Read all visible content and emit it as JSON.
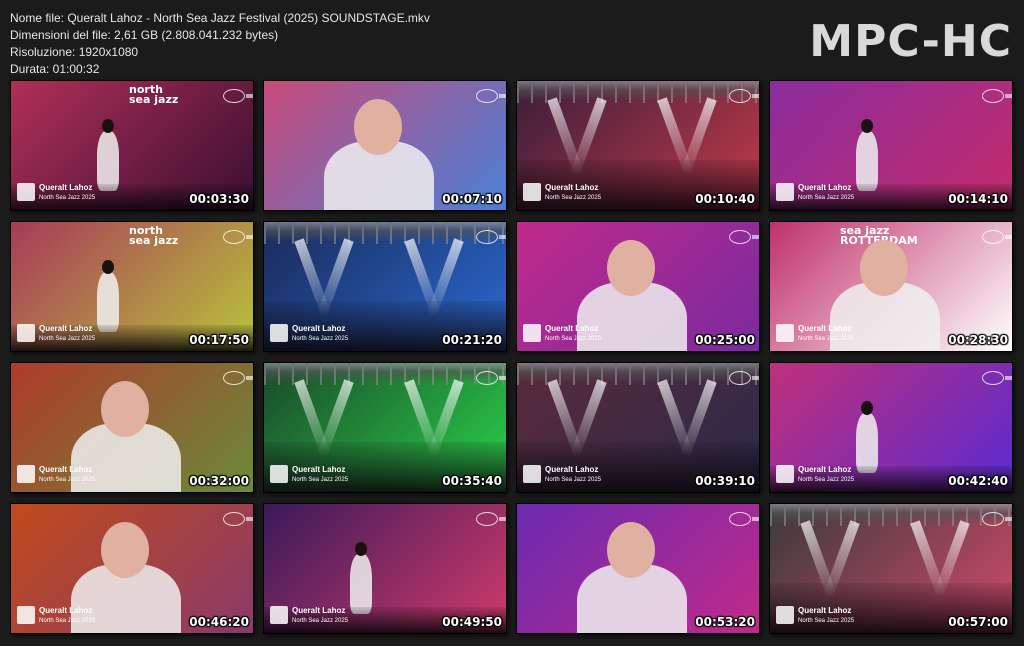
{
  "info": {
    "filename": "Nome file: Queralt Lahoz - North Sea Jazz Festival (2025) SOUNDSTAGE.mkv",
    "filesize": "Dimensioni del file: 2,61 GB (2.808.041.232 bytes)",
    "resolution": "Risoluzione: 1920x1080",
    "duration": "Durata: 01:00:32"
  },
  "brand": "MPC-HC",
  "lower_third": {
    "name": "Queralt Lahoz",
    "event": "North Sea Jazz 2025"
  },
  "thumbs": [
    {
      "time": "00:03:30",
      "colors": [
        "#b02f58",
        "#3a0f30"
      ],
      "scene": "stage-wide-sign",
      "sign": "north\nsea jazz",
      "lt": true
    },
    {
      "time": "00:07:10",
      "colors": [
        "#c94b7a",
        "#4a7fd6"
      ],
      "scene": "closeup",
      "lt": false
    },
    {
      "time": "00:10:40",
      "colors": [
        "#3b1e3a",
        "#c23a4a"
      ],
      "scene": "lights",
      "lt": true
    },
    {
      "time": "00:14:10",
      "colors": [
        "#8b2d9e",
        "#c32b6b"
      ],
      "scene": "arms-up",
      "lt": true
    },
    {
      "time": "00:17:50",
      "colors": [
        "#a83a5a",
        "#b8c43a"
      ],
      "scene": "stage-wide-sign",
      "sign": "north\nsea jazz",
      "lt": true
    },
    {
      "time": "00:21:20",
      "colors": [
        "#1a2a5a",
        "#2a6ad0"
      ],
      "scene": "wide-crowd",
      "lt": true
    },
    {
      "time": "00:25:00",
      "colors": [
        "#c02a8a",
        "#7a2aa0"
      ],
      "scene": "closeup",
      "lt": true
    },
    {
      "time": "00:28:30",
      "colors": [
        "#c0306a",
        "#ffffff"
      ],
      "scene": "closeup-sign",
      "sign": "sea jazz\nROTTERDAM",
      "lt": true
    },
    {
      "time": "00:32:00",
      "colors": [
        "#b03a2a",
        "#6a8a3a"
      ],
      "scene": "closeup",
      "lt": true
    },
    {
      "time": "00:35:40",
      "colors": [
        "#1a4a2a",
        "#2ad04a"
      ],
      "scene": "wide-crowd",
      "lt": true
    },
    {
      "time": "00:39:10",
      "colors": [
        "#5a2a3a",
        "#2a2a4a"
      ],
      "scene": "wide-crowd",
      "lt": true
    },
    {
      "time": "00:42:40",
      "colors": [
        "#c0307a",
        "#5a2ad0"
      ],
      "scene": "stage-single",
      "lt": true
    },
    {
      "time": "00:46:20",
      "colors": [
        "#c04a1a",
        "#8a3a6a"
      ],
      "scene": "closeup",
      "lt": true
    },
    {
      "time": "00:49:50",
      "colors": [
        "#3a1a5a",
        "#d03a6a"
      ],
      "scene": "stage-single",
      "lt": true
    },
    {
      "time": "00:53:20",
      "colors": [
        "#6a2ab0",
        "#c02a8a"
      ],
      "scene": "closeup",
      "lt": false
    },
    {
      "time": "00:57:00",
      "colors": [
        "#3a3a3a",
        "#d04a6a"
      ],
      "scene": "lights-dancer",
      "lt": true
    }
  ]
}
